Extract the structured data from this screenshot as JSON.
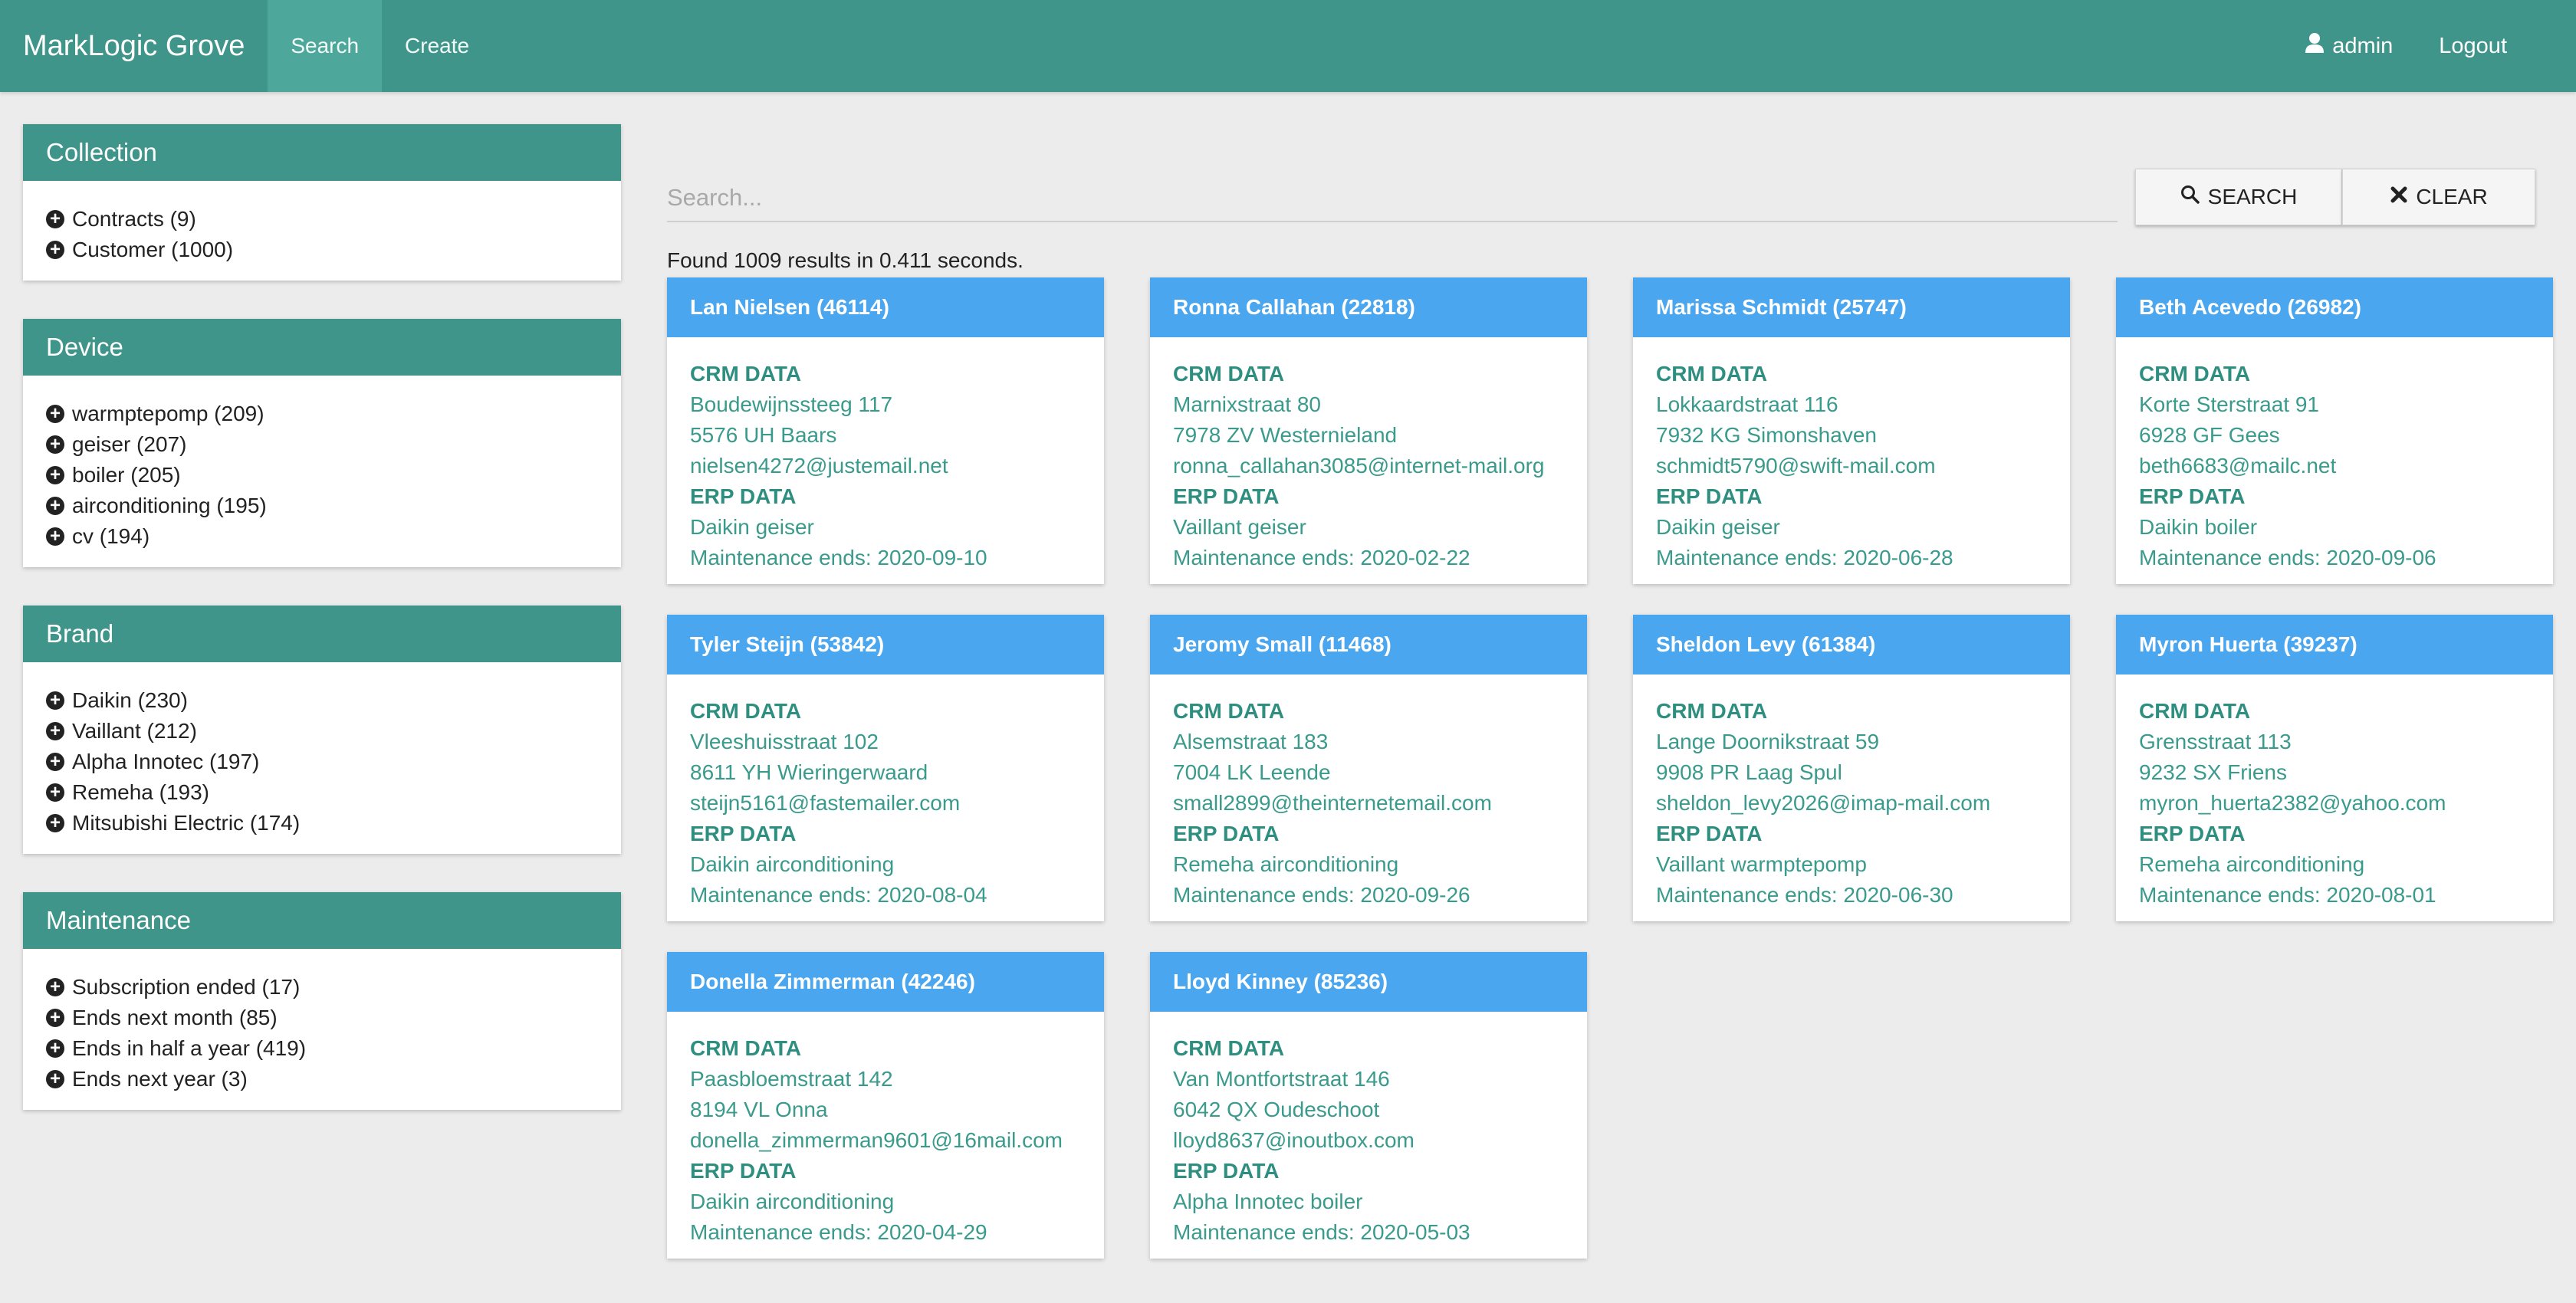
{
  "nav": {
    "brand": "MarkLogic Grove",
    "links": [
      "Search",
      "Create"
    ],
    "user": "admin",
    "logout": "Logout"
  },
  "facets": [
    {
      "title": "Collection",
      "items": [
        "Contracts (9)",
        "Customer (1000)"
      ]
    },
    {
      "title": "Device",
      "items": [
        "warmptepomp (209)",
        "geiser (207)",
        "boiler (205)",
        "airconditioning (195)",
        "cv (194)"
      ]
    },
    {
      "title": "Brand",
      "items": [
        "Daikin (230)",
        "Vaillant (212)",
        "Alpha Innotec (197)",
        "Remeha (193)",
        "Mitsubishi Electric (174)"
      ]
    },
    {
      "title": "Maintenance",
      "items": [
        "Subscription ended (17)",
        "Ends next month (85)",
        "Ends in half a year (419)",
        "Ends next year (3)"
      ]
    }
  ],
  "search": {
    "placeholder": "Search...",
    "value": "",
    "search_label": "SEARCH",
    "clear_label": "CLEAR"
  },
  "results_summary": "Found 1009 results in 0.411 seconds.",
  "crm_label": "CRM DATA",
  "erp_label": "ERP DATA",
  "results": [
    {
      "name": "Lan Nielsen (46114)",
      "street": "Boudewijnssteeg 117",
      "city": "5576 UH Baars",
      "email": "nielsen4272@justemail.net",
      "device": "Daikin geiser",
      "maintenance": "Maintenance ends: 2020-09-10"
    },
    {
      "name": "Ronna Callahan (22818)",
      "street": "Marnixstraat 80",
      "city": "7978 ZV Westernieland",
      "email": "ronna_callahan3085@internet-mail.org",
      "device": "Vaillant geiser",
      "maintenance": "Maintenance ends: 2020-02-22"
    },
    {
      "name": "Marissa Schmidt (25747)",
      "street": "Lokkaardstraat 116",
      "city": "7932 KG Simonshaven",
      "email": "schmidt5790@swift-mail.com",
      "device": "Daikin geiser",
      "maintenance": "Maintenance ends: 2020-06-28"
    },
    {
      "name": "Beth Acevedo (26982)",
      "street": "Korte Sterstraat 91",
      "city": "6928 GF Gees",
      "email": "beth6683@mailc.net",
      "device": "Daikin boiler",
      "maintenance": "Maintenance ends: 2020-09-06"
    },
    {
      "name": "Tyler Steijn (53842)",
      "street": "Vleeshuisstraat 102",
      "city": "8611 YH Wieringerwaard",
      "email": "steijn5161@fastemailer.com",
      "device": "Daikin airconditioning",
      "maintenance": "Maintenance ends: 2020-08-04"
    },
    {
      "name": "Jeromy Small (11468)",
      "street": "Alsemstraat 183",
      "city": "7004 LK Leende",
      "email": "small2899@theinternetemail.com",
      "device": "Remeha airconditioning",
      "maintenance": "Maintenance ends: 2020-09-26"
    },
    {
      "name": "Sheldon Levy (61384)",
      "street": "Lange Doornikstraat 59",
      "city": "9908 PR Laag Spul",
      "email": "sheldon_levy2026@imap-mail.com",
      "device": "Vaillant warmptepomp",
      "maintenance": "Maintenance ends: 2020-06-30"
    },
    {
      "name": "Myron Huerta (39237)",
      "street": "Grensstraat 113",
      "city": "9232 SX Friens",
      "email": "myron_huerta2382@yahoo.com",
      "device": "Remeha airconditioning",
      "maintenance": "Maintenance ends: 2020-08-01"
    },
    {
      "name": "Donella Zimmerman (42246)",
      "street": "Paasbloemstraat 142",
      "city": "8194 VL Onna",
      "email": "donella_zimmerman9601@16mail.com",
      "device": "Daikin airconditioning",
      "maintenance": "Maintenance ends: 2020-04-29"
    },
    {
      "name": "Lloyd Kinney (85236)",
      "street": "Van Montfortstraat 146",
      "city": "6042 QX Oudeschoot",
      "email": "lloyd8637@inoutbox.com",
      "device": "Alpha Innotec boiler",
      "maintenance": "Maintenance ends: 2020-05-03"
    }
  ]
}
